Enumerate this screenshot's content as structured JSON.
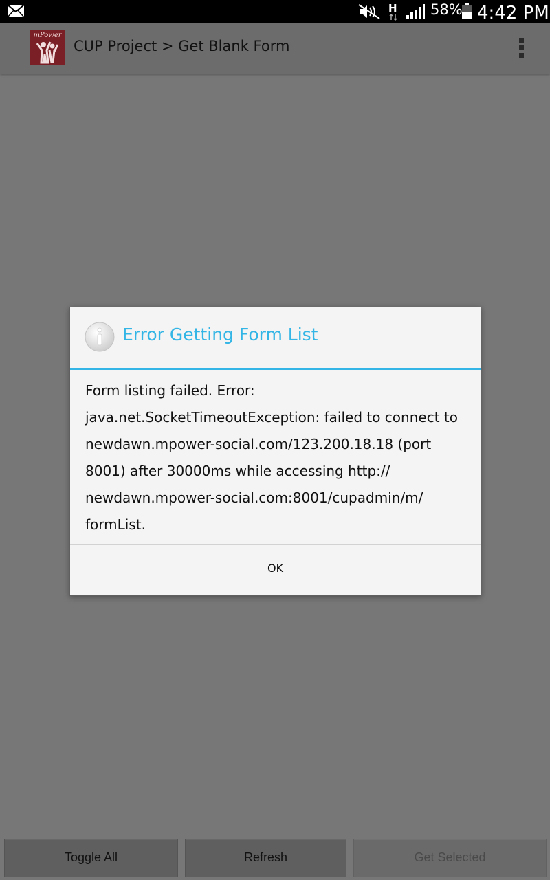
{
  "status_bar": {
    "battery_percent": "58%",
    "time": "4:42 PM",
    "icons": [
      "mail-icon",
      "mute-icon",
      "network-hplus-icon",
      "signal-icon",
      "battery-icon"
    ]
  },
  "action_bar": {
    "logo_text": "mPower",
    "title": "CUP Project > Get Blank Form",
    "menu_icon": "overflow-menu-icon"
  },
  "dialog": {
    "icon": "info-icon",
    "title": "Error Getting Form List",
    "accent_color": "#33b5e5",
    "message_lines": [
      "Form listing failed. Error:",
      "java.net.SocketTimeoutException: failed to connect to",
      "newdawn.mpower-social.com/123.200.18.18 (port",
      "8001) after 30000ms while accessing http://",
      "newdawn.mpower-social.com:8001/cupadmin/m/",
      "formList."
    ],
    "ok_label": "OK"
  },
  "bottom_buttons": {
    "toggle_all": "Toggle All",
    "refresh": "Refresh",
    "get_selected": "Get Selected"
  }
}
